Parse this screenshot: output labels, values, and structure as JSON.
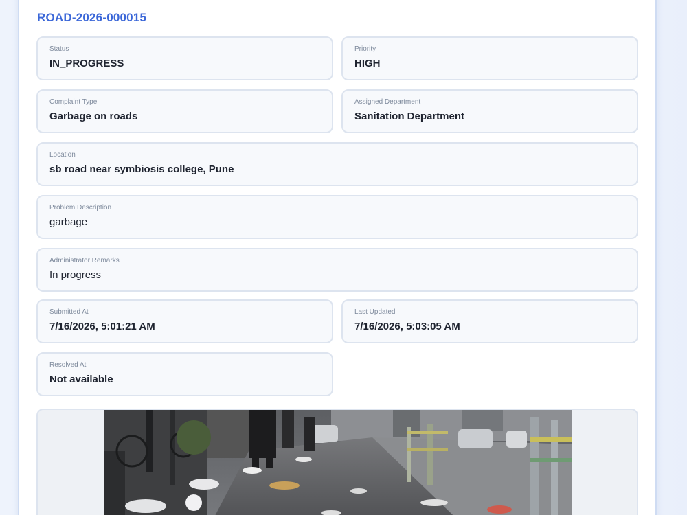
{
  "complaint": {
    "id": "ROAD-2026-000015"
  },
  "fields": {
    "status": {
      "label": "Status",
      "value": "IN_PROGRESS"
    },
    "priority": {
      "label": "Priority",
      "value": "HIGH"
    },
    "complaint_type": {
      "label": "Complaint Type",
      "value": "Garbage on roads"
    },
    "assigned_department": {
      "label": "Assigned Department",
      "value": "Sanitation Department"
    },
    "location": {
      "label": "Location",
      "value": "sb road near symbiosis college, Pune"
    },
    "problem_description": {
      "label": "Problem Description",
      "value": "garbage"
    },
    "admin_remarks": {
      "label": "Administrator Remarks",
      "value": "In progress"
    },
    "submitted_at": {
      "label": "Submitted At",
      "value": "7/16/2026, 5:01:21 AM"
    },
    "last_updated": {
      "label": "Last Updated",
      "value": "7/16/2026, 5:03:05 AM"
    },
    "resolved_at": {
      "label": "Resolved At",
      "value": "Not available"
    }
  },
  "colors": {
    "accent": "#3b67d8",
    "card_bg": "#ffffff",
    "field_bg": "#f7f9fc",
    "field_border": "#dde4ef"
  }
}
